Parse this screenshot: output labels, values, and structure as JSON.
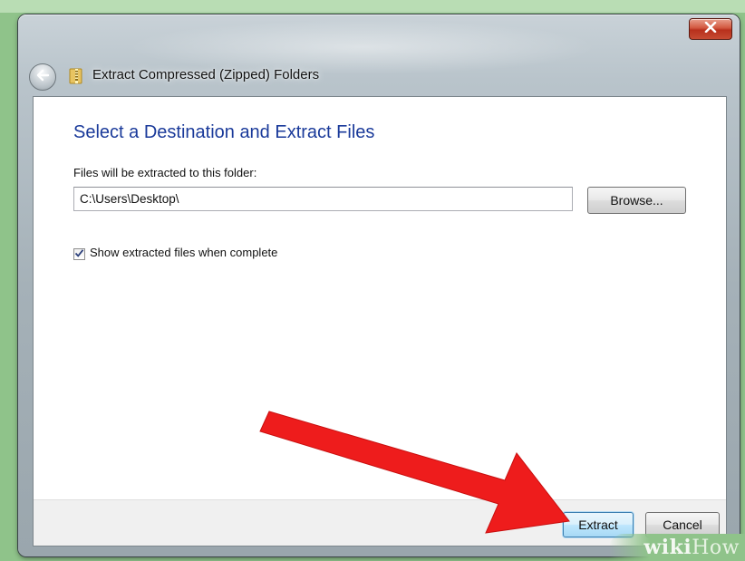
{
  "window": {
    "title": "Extract Compressed (Zipped) Folders",
    "close_glyph": "✕"
  },
  "content": {
    "heading": "Select a Destination and Extract Files",
    "destination_label": "Files will be extracted to this folder:",
    "destination_path": "C:\\Users\\Desktop\\",
    "browse_label": "Browse...",
    "show_files_label": "Show extracted files when complete",
    "show_files_checked": true
  },
  "footer": {
    "extract_label": "Extract",
    "cancel_label": "Cancel"
  },
  "watermark": {
    "part1": "wiki",
    "part2": "How"
  },
  "colors": {
    "heading": "#1a3a9a",
    "arrow": "#ee1c1c",
    "close_button": "#c64a32",
    "background": "#8fc38a"
  },
  "icons": {
    "back": "back-arrow-icon",
    "folder": "zip-folder-icon",
    "close": "close-icon",
    "check": "checkmark-icon",
    "annotation": "red-arrow-annotation"
  }
}
